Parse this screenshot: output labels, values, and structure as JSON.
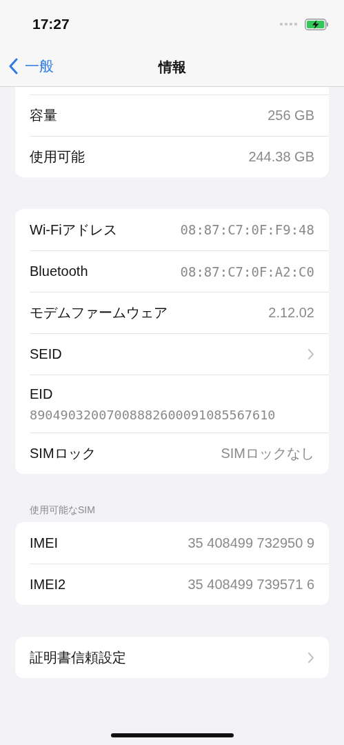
{
  "status_bar": {
    "time": "17:27"
  },
  "nav": {
    "back": "一般",
    "title": "情報"
  },
  "groups": [
    {
      "cut_top": true,
      "rows": [
        {
          "kind": "value",
          "label": "容量",
          "value": "256 GB"
        },
        {
          "kind": "value",
          "label": "使用可能",
          "value": "244.38 GB"
        }
      ]
    },
    {
      "rows": [
        {
          "kind": "mono",
          "label": "Wi-Fiアドレス",
          "value": "08:87:C7:0F:F9:48"
        },
        {
          "kind": "mono",
          "label": "Bluetooth",
          "value": "08:87:C7:0F:A2:C0"
        },
        {
          "kind": "value",
          "label": "モデムファームウェア",
          "value": "2.12.02"
        },
        {
          "kind": "link",
          "label": "SEID"
        },
        {
          "kind": "stacked",
          "label": "EID",
          "value": "89049032007008882600091085567610"
        },
        {
          "kind": "value",
          "label": "SIMロック",
          "value": "SIMロックなし"
        }
      ]
    },
    {
      "header": "使用可能なSIM",
      "rows": [
        {
          "kind": "value",
          "label": "IMEI",
          "value": "35 408499 732950 9"
        },
        {
          "kind": "value",
          "label": "IMEI2",
          "value": "35 408499 739571 6"
        }
      ]
    },
    {
      "rows": [
        {
          "kind": "link",
          "label": "証明書信頼設定"
        }
      ]
    }
  ]
}
